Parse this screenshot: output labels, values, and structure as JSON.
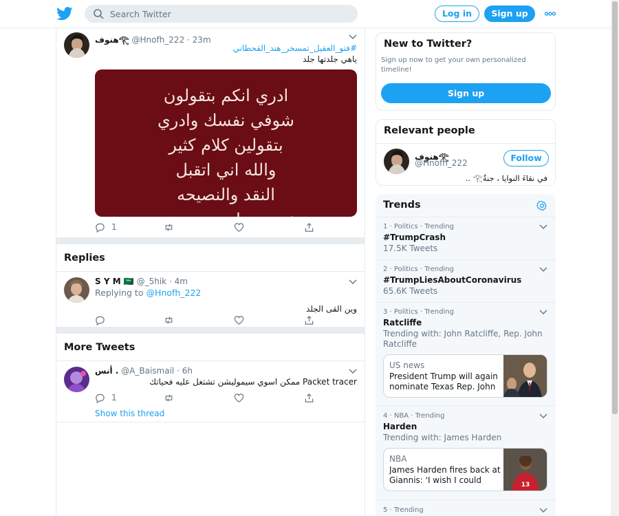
{
  "search": {
    "placeholder": "Search Twitter"
  },
  "header": {
    "login_label": "Log in",
    "signup_label": "Sign up"
  },
  "colors": {
    "accent": "#1da1f2",
    "text": "#14171a",
    "muted": "#657786",
    "border": "#e6ecf0"
  },
  "main_tweet": {
    "name": "هنوف𓂀",
    "handle": "@Hnofh_222",
    "time": "· 23m",
    "hashtag": "#فتو_العقيل_تمسخر_هند_القحطاني",
    "text": "ياهي جلدتها جلد",
    "image_lines": [
      "ادري انكم بتقولون",
      "شوفي نفسك وادري",
      "بتقولين كلام كثير",
      "والله اني اتقبل",
      "النقد والنصيحه",
      "عمري ماسبيت وحده"
    ],
    "reply_count": "1"
  },
  "replies": {
    "title": "Replies",
    "items": [
      {
        "name": "S Y M 🇸🇦",
        "handle": "@_5hik",
        "time": "· 4m",
        "replying_prefix": "Replying to",
        "replying_to": "@Hnofh_222",
        "text": "وين القى الجلد"
      }
    ]
  },
  "more_tweets": {
    "title": "More Tweets",
    "items": [
      {
        "name": "أنس .",
        "handle": "@A_Baismail",
        "time": "· 6h",
        "text": "Packet tracer ممكن اسوي سيموليشن تشتغل عليه فحياتك",
        "reply_count": "1",
        "thread_link": "Show this thread"
      }
    ]
  },
  "new_to_twitter": {
    "title": "New to Twitter?",
    "subtitle": "Sign up now to get your own personalized timeline!",
    "button": "Sign up"
  },
  "relevant_people": {
    "title": "Relevant people",
    "name": "هنوف𓂀",
    "handle": "@Hnofh_222",
    "follow_label": "Follow",
    "bio": "في نقاءَ النوايا ، جنةٌ𓂀 .."
  },
  "trends": {
    "title": "Trends",
    "items": [
      {
        "context": "1 · Politics · Trending",
        "name": "#TrumpCrash",
        "sub": "17.5K Tweets"
      },
      {
        "context": "2 · Politics · Trending",
        "name": "#TrumpLiesAboutCoronavirus",
        "sub": "65.6K Tweets"
      },
      {
        "context": "3 · Politics · Trending",
        "name": "Ratcliffe",
        "sub": "Trending with: John Ratcliffe, Rep. John Ratcliffe",
        "news_source": "US news",
        "news_title": "President Trump will again nominate Texas Rep. John ..."
      },
      {
        "context": "4 · NBA · Trending",
        "name": "Harden",
        "sub": "Trending with: James Harden",
        "news_source": "NBA",
        "news_title": "James Harden fires back at Giannis: 'I wish I could jus..."
      },
      {
        "context": "5 · Trending"
      }
    ]
  }
}
